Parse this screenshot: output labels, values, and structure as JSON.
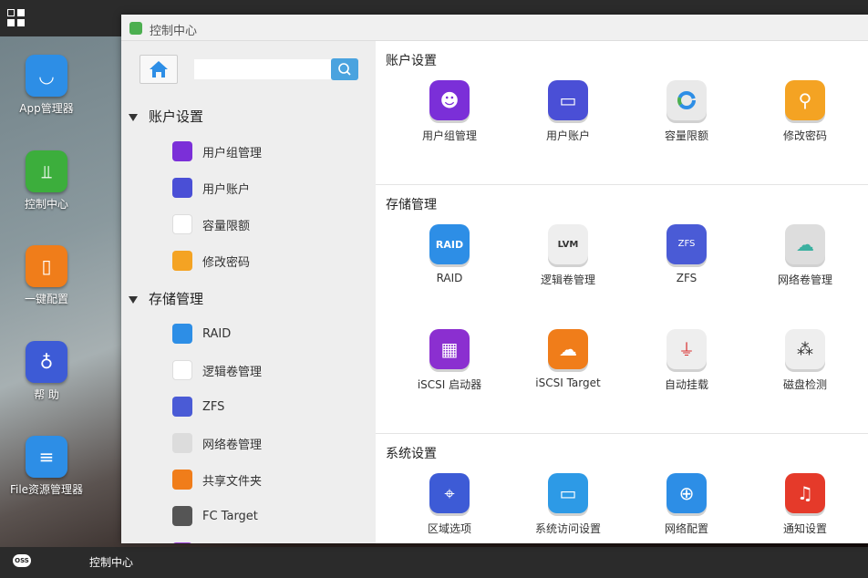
{
  "desktop": {
    "icons": [
      {
        "label": "App管理器",
        "color": "#2d8ee6"
      },
      {
        "label": "控制中心",
        "color": "#3cae3c"
      },
      {
        "label": "一键配置",
        "color": "#f07d1a"
      },
      {
        "label": "帮 助",
        "color": "#3d5bd6"
      },
      {
        "label": "File资源管理器",
        "color": "#2d8ee6"
      }
    ]
  },
  "taskbar": {
    "logo": "OSS",
    "active_task": "控制中心"
  },
  "window": {
    "title": "控制中心",
    "search": {
      "placeholder": "",
      "value": ""
    },
    "sidebar": {
      "sections": [
        {
          "label": "账户设置",
          "items": [
            "用户组管理",
            "用户账户",
            "容量限额",
            "修改密码"
          ]
        },
        {
          "label": "存储管理",
          "items": [
            "RAID",
            "逻辑卷管理",
            "ZFS",
            "网络卷管理",
            "共享文件夹",
            "FC Target"
          ]
        }
      ]
    },
    "content": {
      "sections": [
        {
          "title": "账户设置",
          "tiles": [
            {
              "label": "用户组管理",
              "icon": "user-group-icon",
              "color": "#7b2fd8"
            },
            {
              "label": "用户账户",
              "icon": "user-account-icon",
              "color": "#4a4fd6"
            },
            {
              "label": "容量限额",
              "icon": "quota-icon",
              "color": "#e9e9e9"
            },
            {
              "label": "修改密码",
              "icon": "password-icon",
              "color": "#f4a323"
            }
          ]
        },
        {
          "title": "存储管理",
          "tiles": [
            {
              "label": "RAID",
              "icon": "raid-icon",
              "color": "#2d8ee6"
            },
            {
              "label": "逻辑卷管理",
              "icon": "lvm-icon",
              "color": "#eeeeee"
            },
            {
              "label": "ZFS",
              "icon": "zfs-icon",
              "color": "#4a5bd6"
            },
            {
              "label": "网络卷管理",
              "icon": "netdrive-icon",
              "color": "#dddddd"
            },
            {
              "label": "iSCSI 启动器",
              "icon": "iscsi-initiator-icon",
              "color": "#8b2fd0"
            },
            {
              "label": "iSCSI Target",
              "icon": "iscsi-target-icon",
              "color": "#f07d1a"
            },
            {
              "label": "自动挂载",
              "icon": "automount-icon",
              "color": "#eeeeee"
            },
            {
              "label": "磁盘检测",
              "icon": "disk-check-icon",
              "color": "#eeeeee"
            }
          ]
        },
        {
          "title": "系统设置",
          "tiles": [
            {
              "label": "区域选项",
              "icon": "region-icon",
              "color": "#3d5bd6"
            },
            {
              "label": "系统访问设置",
              "icon": "system-access-icon",
              "color": "#2d9ae6"
            },
            {
              "label": "网络配置",
              "icon": "network-icon",
              "color": "#2d8ee6"
            },
            {
              "label": "通知设置",
              "icon": "notification-icon",
              "color": "#e53a2a"
            }
          ]
        }
      ]
    }
  }
}
